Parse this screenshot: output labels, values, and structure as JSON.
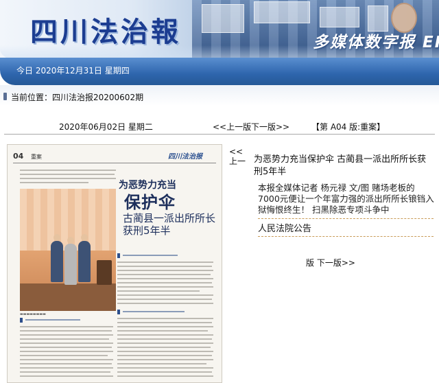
{
  "banner": {
    "logo_text": "四川法治報",
    "tagline": "多媒体数字报 EP.",
    "date_line": "今日  2020年12月31日  星期四"
  },
  "breadcrumb": {
    "label": "当前位置：四川法治报20200602期"
  },
  "issue_nav": {
    "date": "2020年06月02日 星期二",
    "prev": "<<上一版",
    "next": "下一版>>",
    "edition": "【第 A04 版:重案】"
  },
  "paper_image": {
    "page_number": "04",
    "section": "重案",
    "masthead": "四川法治报",
    "headline_line1": "为恶势力充当",
    "headline_line2": "保护伞",
    "subhead_line1": "古蔺县一派出所所长",
    "subhead_line2": "获刑5年半"
  },
  "article_list": {
    "prev_label": "<<上一",
    "items": [
      {
        "title": "为恶势力充当保护伞 古蔺县一派出所所长获刑5年半",
        "summary": "本报全媒体记者 杨元禄 文/图          赌场老板的7000元便让一个年富力强的派出所所长锒铛入狱悔恨终生！       扫黑除恶专项斗争中"
      },
      {
        "title": "人民法院公告",
        "summary": ""
      }
    ],
    "next_label": "版  下一版>>"
  },
  "colors": {
    "banner_blue": "#2e65ad",
    "logo_blue": "#1c3d91",
    "divider_gold": "#c99b57"
  }
}
